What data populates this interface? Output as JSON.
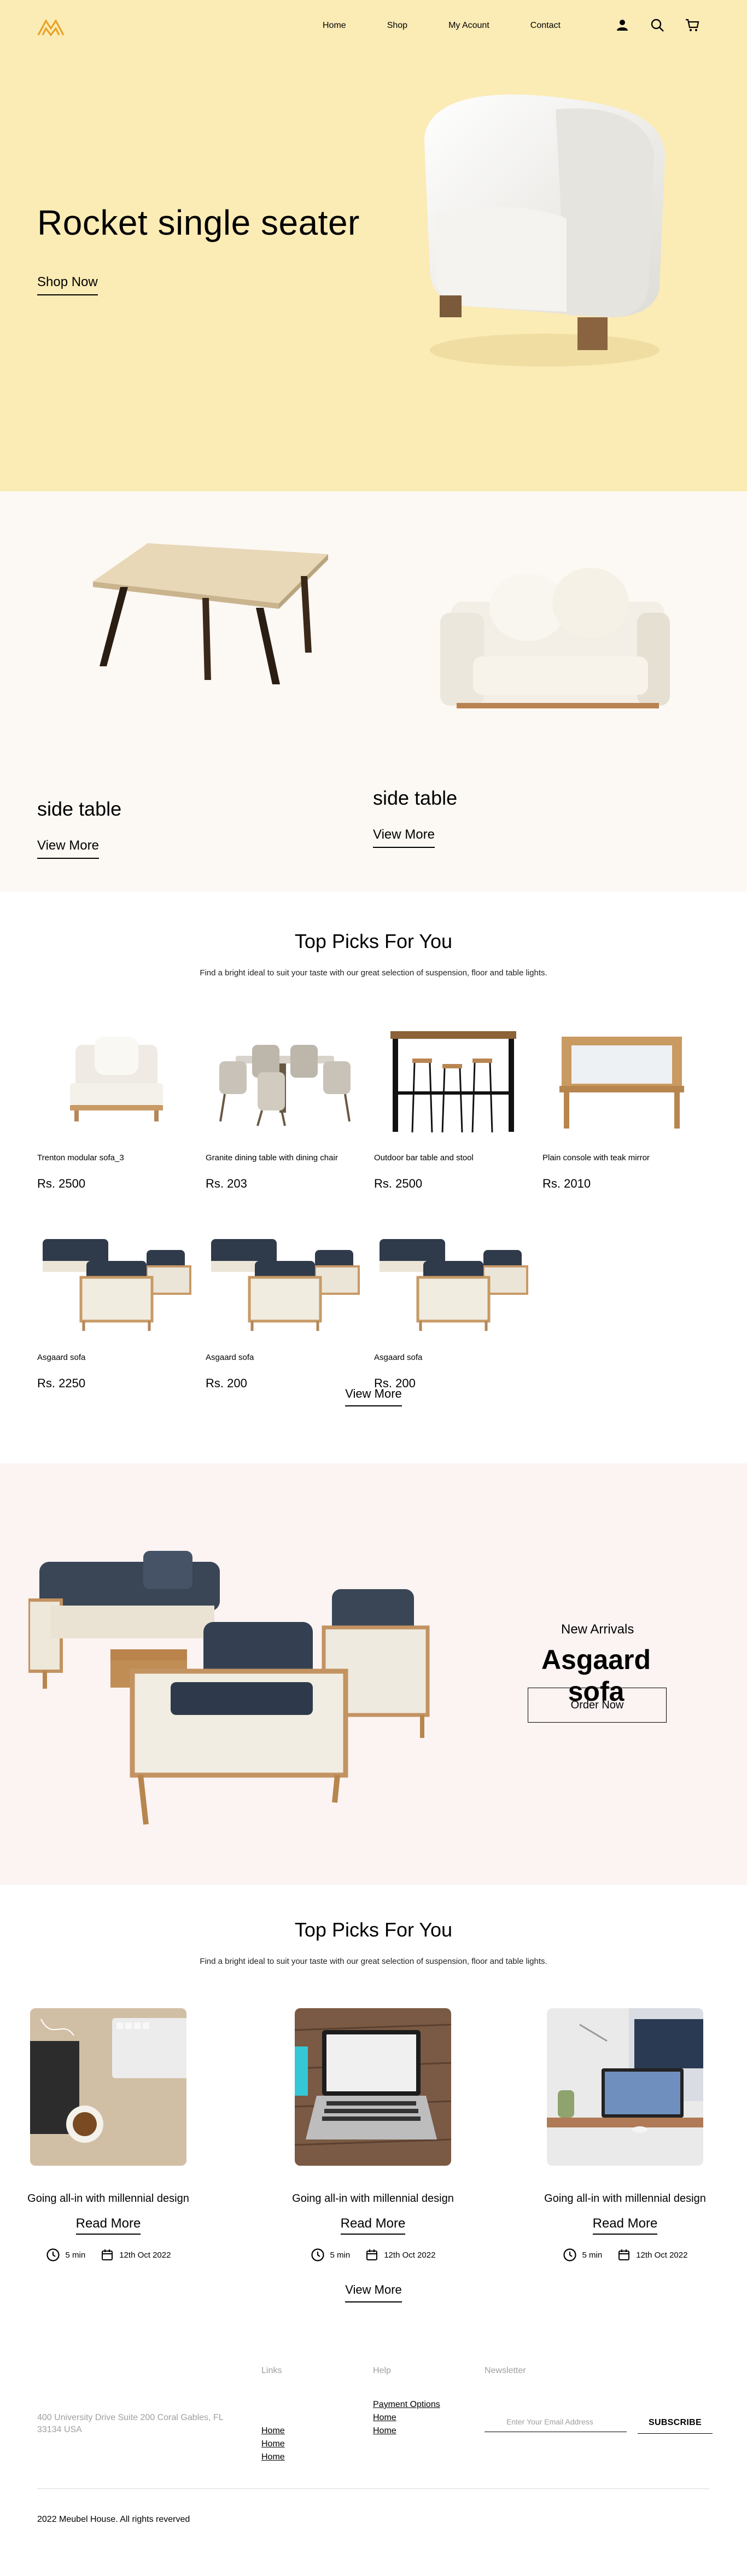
{
  "colors": {
    "hero_bg": "#fbebb5",
    "featured_bg": "#fcf8f3",
    "arrivals_bg": "#fcf3f3",
    "logo": "#e89f1f"
  },
  "nav": {
    "items": [
      "Home",
      "Shop",
      "My Acount",
      "Contact"
    ],
    "icons": [
      "user-icon",
      "search-icon",
      "cart-icon"
    ]
  },
  "hero": {
    "title": "Rocket single seater",
    "cta": "Shop Now"
  },
  "featured": [
    {
      "name": "side table",
      "cta": "View More"
    },
    {
      "name": "side table",
      "cta": "View More"
    }
  ],
  "top_picks": {
    "title": "Top Picks For You",
    "subtitle": "Find a bright ideal to suit your taste with our great selection of suspension, floor and table lights.",
    "products": [
      {
        "name": "Trenton modular sofa_3",
        "price": "Rs. 2500"
      },
      {
        "name": "Granite dining table with dining chair",
        "price": "Rs. 203"
      },
      {
        "name": "Outdoor bar table and stool",
        "price": "Rs. 2500"
      },
      {
        "name": "Plain console with teak mirror",
        "price": "Rs. 2010"
      },
      {
        "name": "Asgaard sofa",
        "price": "Rs. 2250"
      },
      {
        "name": "Asgaard sofa",
        "price": "Rs. 200"
      },
      {
        "name": "Asgaard sofa",
        "price": "Rs. 200"
      }
    ],
    "cta": "View More"
  },
  "arrivals": {
    "label": "New Arrivals",
    "name": "Asgaard sofa",
    "cta": "Order Now"
  },
  "blog": {
    "title": "Top Picks For You",
    "subtitle": "Find a bright ideal to suit your taste with our great selection of suspension, floor and table lights.",
    "posts": [
      {
        "title": "Going all-in with millennial design",
        "cta": "Read More",
        "time": "5 min",
        "date": "12th Oct 2022"
      },
      {
        "title": "Going all-in with millennial design",
        "cta": "Read More",
        "time": "5 min",
        "date": "12th Oct 2022"
      },
      {
        "title": "Going all-in with millennial design",
        "cta": "Read More",
        "time": "5 min",
        "date": "12th Oct 2022"
      }
    ],
    "cta": "View More"
  },
  "footer": {
    "address": "400 University Drive Suite 200 Coral Gables, FL 33134 USA",
    "links_title": "Links",
    "links": [
      "Home",
      "Home",
      "Home"
    ],
    "help_title": "Help",
    "help": [
      "Payment Options",
      "Home",
      "Home"
    ],
    "newsletter_title": "Newsletter",
    "email_placeholder": "Enter Your Email Address",
    "subscribe": "SUBSCRIBE",
    "copyright": "2022 Meubel House. All rights reverved"
  }
}
